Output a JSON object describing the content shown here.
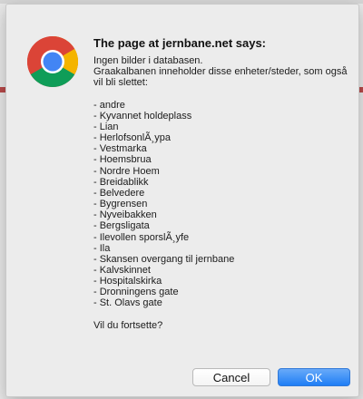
{
  "dialog": {
    "title": "The page at jernbane.net says:",
    "message": "Ingen bilder i databasen.\nGraakalbanen inneholder disse enheter/steder, som også vil bli slettet:\n\n- andre\n- Kyvannet holdeplass\n- Lian\n- HerlofsonlÃ¸ypa\n- Vestmarka\n- Hoemsbrua\n- Nordre Hoem\n- Breidablikk\n- Belvedere\n- Bygrensen\n- Nyveibakken\n- Bergsligata\n- Ilevollen sporslÃ¸yfe\n- Ila\n- Skansen overgang til jernbane\n- Kalvskinnet\n- Hospitalskirka\n- Dronningens gate\n- St. Olavs gate\n\nVil du fortsette?",
    "cancel_label": "Cancel",
    "ok_label": "OK",
    "icon": "chrome-icon"
  },
  "colors": {
    "ok_button": "#1f7ef5",
    "dialog_bg": "#ececec"
  }
}
